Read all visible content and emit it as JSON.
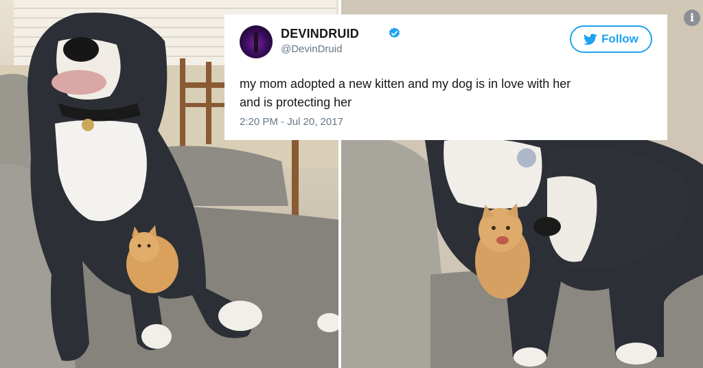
{
  "tweet": {
    "display_name": "DEVINDRUID",
    "handle": "@DevinDruid",
    "follow_label": "Follow",
    "text_line1": "my mom adopted a new kitten and my dog is in love with her",
    "text_line2": "and is protecting her",
    "timestamp": "2:20 PM - Jul 20, 2017",
    "verified": true
  },
  "icons": {
    "verified": "verified-check-icon",
    "bird": "twitter-bird-icon",
    "info": "info-icon",
    "info_glyph": "i"
  },
  "colors": {
    "twitter_blue": "#1da1f2",
    "text_primary": "#14171a",
    "text_secondary": "#657786",
    "dog_coat": "#2c2f36",
    "dog_chest": "#f4f2ee",
    "kitten": "#d9a15c",
    "couch": "#8c8a85"
  }
}
